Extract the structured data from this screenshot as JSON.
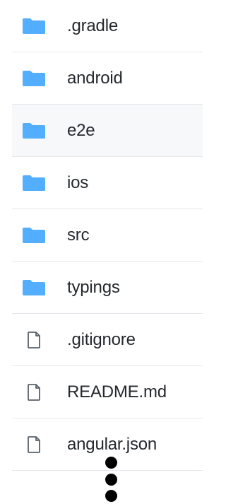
{
  "colors": {
    "folder": "#54aeff",
    "file_outline": "#57606a",
    "text": "#24292f",
    "row_highlight": "#f6f8fa",
    "divider": "#e4e8ec"
  },
  "files": [
    {
      "name": ".gradle",
      "type": "folder",
      "icon": "folder-icon"
    },
    {
      "name": "android",
      "type": "folder",
      "icon": "folder-icon"
    },
    {
      "name": "e2e",
      "type": "folder",
      "icon": "folder-icon",
      "highlighted": true
    },
    {
      "name": "ios",
      "type": "folder",
      "icon": "folder-icon"
    },
    {
      "name": "src",
      "type": "folder",
      "icon": "folder-icon"
    },
    {
      "name": "typings",
      "type": "folder",
      "icon": "folder-icon"
    },
    {
      "name": ".gitignore",
      "type": "file",
      "icon": "file-icon"
    },
    {
      "name": "README.md",
      "type": "file",
      "icon": "file-icon"
    },
    {
      "name": "angular.json",
      "type": "file",
      "icon": "file-icon"
    }
  ],
  "more_indicator": {
    "icon": "vertical-ellipsis-icon"
  }
}
